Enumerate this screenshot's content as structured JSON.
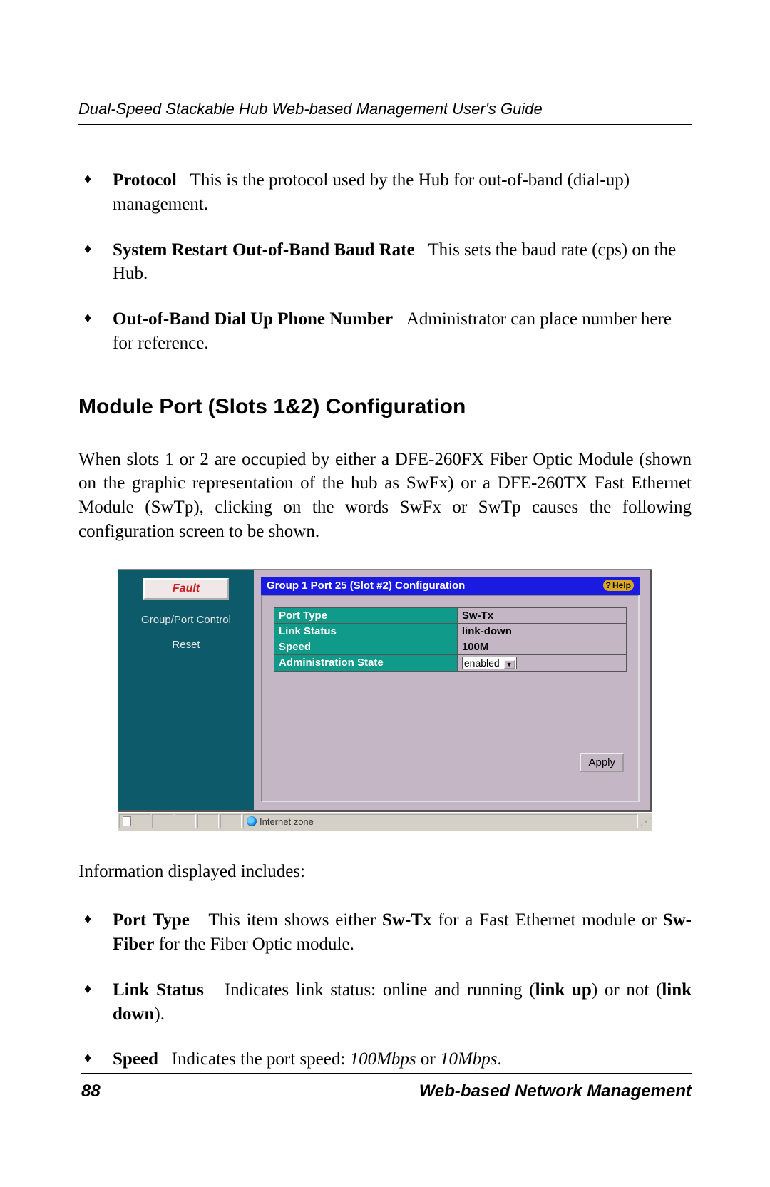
{
  "header": "Dual-Speed Stackable Hub Web-based Management User's Guide",
  "bullets_top": [
    {
      "term": "Protocol",
      "desc": "This is the protocol used by the Hub for out-of-band (dial-up) management."
    },
    {
      "term": "System Restart Out-of-Band Baud Rate",
      "desc": "This sets the baud rate (cps) on the Hub."
    },
    {
      "term": "Out-of-Band Dial Up Phone Number",
      "desc": "Administrator can place number here for reference."
    }
  ],
  "section_heading": "Module Port (Slots 1&2) Configuration",
  "intro_para": "When slots 1 or 2 are occupied by either a DFE-260FX Fiber Optic Module (shown on the graphic representation of the hub as SwFx) or a DFE-260TX Fast Ethernet Module (SwTp), clicking on the words SwFx or SwTp causes the following configuration screen to be shown.",
  "screenshot": {
    "sidebar": {
      "fault": "Fault",
      "items": [
        "Group/Port Control",
        "Reset"
      ]
    },
    "title": "Group 1 Port 25 (Slot #2) Configuration",
    "help_label": "Help",
    "rows": [
      {
        "label": "Port Type",
        "value": "Sw-Tx"
      },
      {
        "label": "Link Status",
        "value": "link-down"
      },
      {
        "label": "Speed",
        "value": "100M"
      },
      {
        "label": "Administration State",
        "value": "enabled"
      }
    ],
    "apply": "Apply",
    "status_zone": "Internet zone"
  },
  "info_intro": "Information displayed includes:",
  "bullets_bottom": {
    "b1": {
      "term": "Port Type",
      "pre": "This item shows either ",
      "bold1": "Sw-Tx",
      "mid": " for a Fast Ethernet module or ",
      "bold2": "Sw-Fiber",
      "post": " for the Fiber Optic module."
    },
    "b2": {
      "term": "Link Status",
      "pre": "Indicates link status: online and running (",
      "bold1": "link up",
      "mid": ") or not (",
      "bold2": "link down",
      "post": ")."
    },
    "b3": {
      "term": "Speed",
      "pre": "Indicates the port speed:  ",
      "it1": "100Mbps",
      "mid": " or ",
      "it2": "10Mbps",
      "post": "."
    }
  },
  "footer": {
    "page": "88",
    "title": "Web-based Network Management"
  }
}
